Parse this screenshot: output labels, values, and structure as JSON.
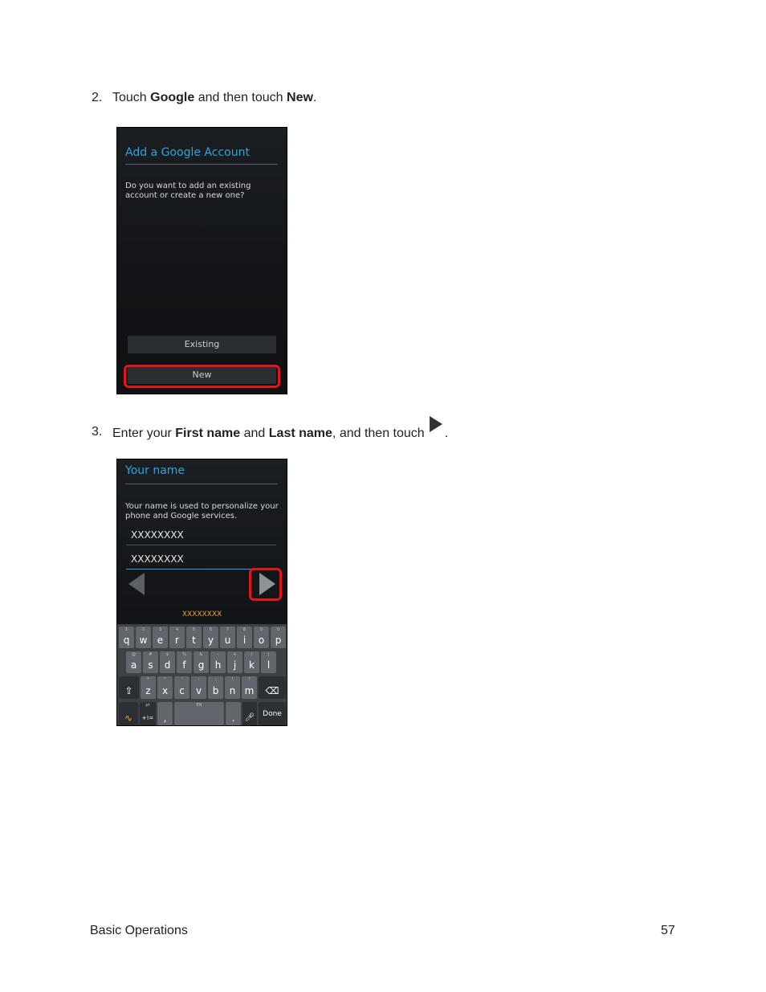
{
  "step2": {
    "number": "2.",
    "pre": "Touch ",
    "bold1": "Google",
    "mid": " and then touch ",
    "bold2": "New",
    "post": "."
  },
  "screen1": {
    "title": "Add a Google Account",
    "question": "Do you want to add an existing account or create a new one?",
    "existing_label": "Existing",
    "new_label": "New"
  },
  "step3": {
    "number": "3.",
    "pre": "Enter your ",
    "bold1": "First name",
    "mid": " and ",
    "bold2": "Last name",
    "post1": ", and then touch",
    "post2": "."
  },
  "screen2": {
    "title": "Your name",
    "description": "Your name is used to personalize your phone and Google services.",
    "first_name_value": "XXXXXXXX",
    "last_name_value": "XXXXXXXX",
    "suggestion": "XXXXXXXX",
    "keyboard": {
      "row1": [
        [
          "q",
          "1"
        ],
        [
          "w",
          "2"
        ],
        [
          "e",
          "3"
        ],
        [
          "r",
          "4"
        ],
        [
          "t",
          "5"
        ],
        [
          "y",
          "6"
        ],
        [
          "u",
          "7"
        ],
        [
          "i",
          "8"
        ],
        [
          "o",
          "9"
        ],
        [
          "p",
          "0"
        ]
      ],
      "row2": [
        [
          "a",
          "@"
        ],
        [
          "s",
          "#"
        ],
        [
          "d",
          "$"
        ],
        [
          "f",
          "%"
        ],
        [
          "g",
          "&"
        ],
        [
          "h",
          "-"
        ],
        [
          "j",
          "+"
        ],
        [
          "k",
          "("
        ],
        [
          "l",
          ")"
        ]
      ],
      "row3": [
        [
          "z",
          "*"
        ],
        [
          "x",
          "\""
        ],
        [
          "c",
          "'"
        ],
        [
          "v",
          ":"
        ],
        [
          "b",
          ";"
        ],
        [
          "n",
          "!"
        ],
        [
          "m",
          "?"
        ]
      ],
      "shift_icon": "shift-arrow-icon",
      "backspace_icon": "backspace-icon",
      "swype_icon": "swype-icon",
      "sym_label": "+!=",
      "sym_sup": "pt",
      "comma": ",",
      "space_sup": "EN",
      "period": ".",
      "mic_icon": "microphone-icon",
      "done_label": "Done"
    }
  },
  "footer": {
    "section": "Basic Operations",
    "page": "57"
  },
  "colors": {
    "accent_blue": "#2aa7dd",
    "highlight_red": "#e0161b",
    "suggestion_orange": "#f2a51a"
  }
}
